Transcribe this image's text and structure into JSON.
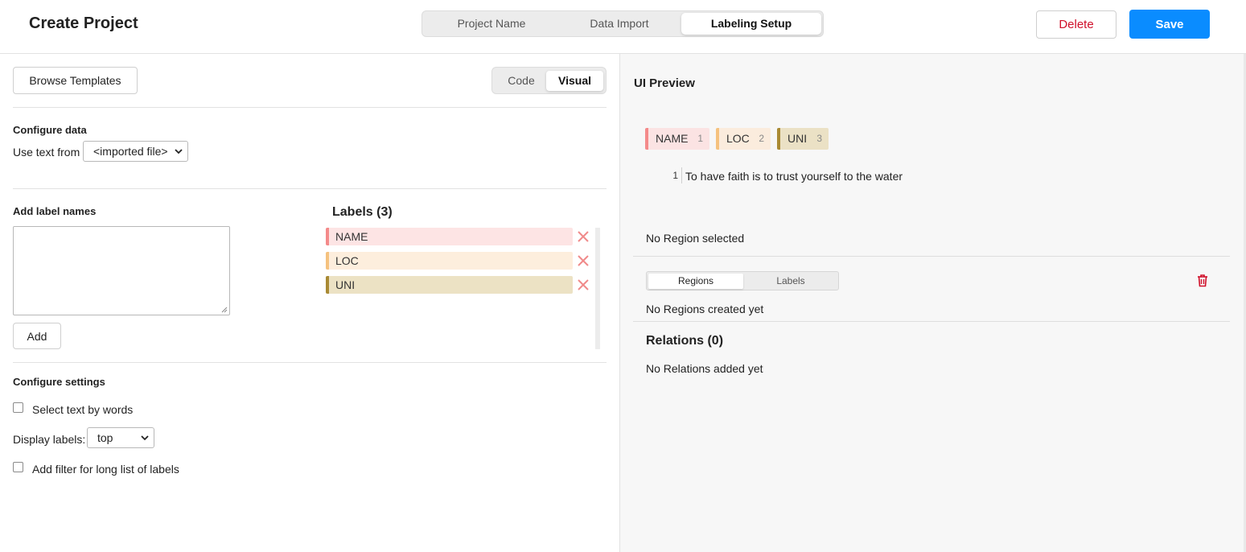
{
  "header": {
    "title": "Create Project",
    "steps": [
      "Project Name",
      "Data Import",
      "Labeling Setup"
    ],
    "active_step": "Labeling Setup",
    "delete_label": "Delete",
    "save_label": "Save"
  },
  "config": {
    "browse_label": "Browse Templates",
    "mode_options": [
      "Code",
      "Visual"
    ],
    "active_mode": "Visual",
    "configure_data": {
      "title": "Configure data",
      "use_text_label": "Use text from",
      "source_value": "<imported file>"
    },
    "add_labels": {
      "title": "Add label names",
      "textarea_value": "",
      "add_label": "Add"
    },
    "labels_title": "Labels (3)",
    "labels": [
      {
        "name": "NAME",
        "color": "#f48a8a",
        "bg": "#fde4e4"
      },
      {
        "name": "LOC",
        "color": "#f5c27f",
        "bg": "#fdeedd"
      },
      {
        "name": "UNI",
        "color": "#a98a34",
        "bg": "#ece2c4"
      }
    ],
    "settings": {
      "title": "Configure settings",
      "select_by_words": "Select text by words",
      "display_labels_label": "Display labels:",
      "display_labels_value": "top",
      "filter_label": "Add filter for long list of labels"
    }
  },
  "preview": {
    "title": "UI Preview",
    "chips": [
      {
        "name": "NAME",
        "hotkey": "1",
        "color": "#f48a8a",
        "bg": "#fbe3e3"
      },
      {
        "name": "LOC",
        "hotkey": "2",
        "color": "#f5c27f",
        "bg": "#fbecdd"
      },
      {
        "name": "UNI",
        "hotkey": "3",
        "color": "#a98a34",
        "bg": "#ebe1c5"
      }
    ],
    "line_number": "1",
    "line_text": "To have faith is to trust yourself to the water",
    "no_region_selected": "No Region selected",
    "tabs": [
      "Regions",
      "Labels"
    ],
    "active_tab": "Regions",
    "no_regions": "No Regions created yet",
    "relations_title": "Relations (0)",
    "no_relations": "No Relations added yet"
  },
  "colors": {
    "accent": "#0a8cff",
    "danger": "#d0102a"
  }
}
